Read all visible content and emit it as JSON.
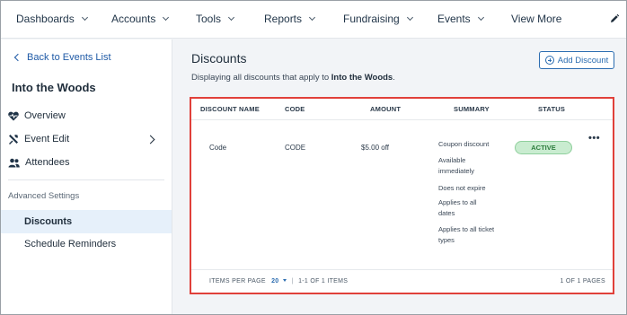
{
  "nav": {
    "items": [
      {
        "label": "Dashboards",
        "dropdown": true
      },
      {
        "label": "Accounts",
        "dropdown": true
      },
      {
        "label": "Tools",
        "dropdown": true
      },
      {
        "label": "Reports",
        "dropdown": true
      },
      {
        "label": "Fundraising",
        "dropdown": true
      },
      {
        "label": "Events",
        "dropdown": true
      },
      {
        "label": "View More",
        "dropdown": false
      }
    ],
    "edit_icon": "pencil-icon"
  },
  "sidebar": {
    "back_label": "Back to Events List",
    "event_title": "Into the Woods",
    "items": [
      {
        "label": "Overview",
        "icon": "heart-pulse-icon"
      },
      {
        "label": "Event Edit",
        "icon": "tools-icon"
      },
      {
        "label": "Attendees",
        "icon": "people-icon"
      }
    ],
    "section_label": "Advanced Settings",
    "sub_items": [
      {
        "label": "Discounts",
        "active": true
      },
      {
        "label": "Schedule Reminders",
        "active": false
      }
    ]
  },
  "main": {
    "title": "Discounts",
    "subtitle_prefix": "Displaying all discounts that apply to ",
    "subtitle_event": "Into the Woods",
    "subtitle_suffix": ".",
    "add_button": "Add Discount"
  },
  "table": {
    "headers": [
      "DISCOUNT NAME",
      "CODE",
      "AMOUNT",
      "SUMMARY",
      "STATUS"
    ],
    "rows": [
      {
        "name": "Code",
        "code": "CODE",
        "amount": "$5.00 off",
        "summary": [
          "Coupon discount",
          "Available",
          "immediately",
          "Does not expire",
          "Applies to all",
          "dates",
          "Applies to all ticket",
          "types"
        ],
        "status": "ACTIVE"
      }
    ],
    "more_label": "•••",
    "footer": {
      "per_page_label": "ITEMS PER PAGE",
      "per_page_value": "20",
      "range": "1-1 OF 1 ITEMS",
      "pages": "1 OF 1 PAGES"
    }
  },
  "colors": {
    "accent": "#2b6cb0",
    "highlight": "#e0403a",
    "active_badge": "#c9ecd0"
  }
}
